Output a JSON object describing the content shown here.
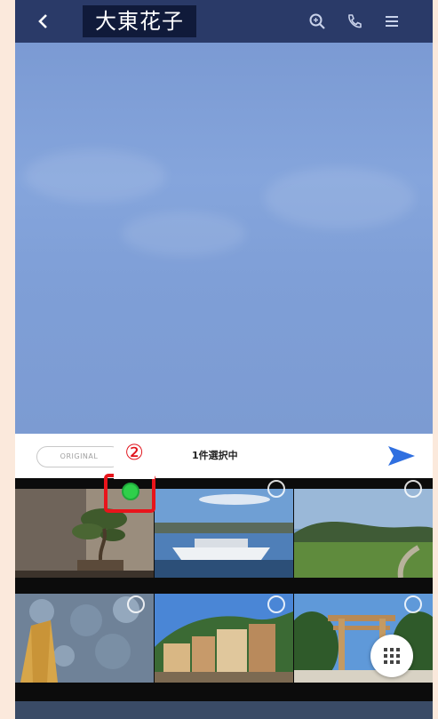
{
  "header": {
    "title": "大東花子",
    "back_icon": "chevron-left-icon",
    "icons": [
      "search-icon",
      "phone-icon",
      "menu-icon"
    ]
  },
  "toolbar": {
    "original_label": "ORIGINAL",
    "selection_count": "1件選択中",
    "send_icon": "send-icon"
  },
  "annotation": {
    "step_marker": "②"
  },
  "gallery": {
    "selected_count": 1,
    "items": [
      "bonsai-photo",
      "harbor-ship-photo",
      "coastal-field-photo",
      "stone-wall-photo",
      "hillside-town-photo",
      "torii-gate-photo"
    ]
  },
  "colors": {
    "header_bg": "#2a3a68",
    "chat_bg": "#7f9fd6",
    "send_accent": "#2f6fe0",
    "selected_indicator": "#2fd04a",
    "highlight_red": "#e8141b"
  }
}
